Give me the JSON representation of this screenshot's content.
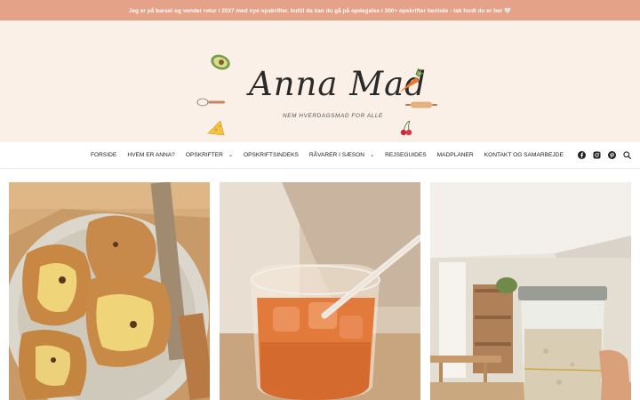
{
  "announcement": "Jeg er på barsel og vender retur i 2027 med nye opskrifter. Indtil da kan du gå på opdagelse i 300+ opskrifter herinde - tak fordi du er her 🤍",
  "logo": {
    "title": "Anna Mad",
    "subtitle": "NEM HVERDAGSMAD FOR ALLE"
  },
  "nav": {
    "items": [
      {
        "label": "FORSIDE"
      },
      {
        "label": "HVEM ER ANNA?"
      },
      {
        "label": "OPSKRIFTER",
        "has_dropdown": true
      },
      {
        "label": "OPSKRIFTSINDEKS"
      },
      {
        "label": "RÅVARER I SÆSON",
        "has_dropdown": true
      },
      {
        "label": "REJSEGUIDES"
      },
      {
        "label": "MADPLANER"
      },
      {
        "label": "KONTAKT OG SAMARBEJDE"
      }
    ],
    "icons": [
      "facebook-icon",
      "instagram-icon",
      "pinterest-icon",
      "search-icon"
    ]
  },
  "colors": {
    "accent": "#e4a288",
    "hero_bg": "#fbf0e7"
  }
}
